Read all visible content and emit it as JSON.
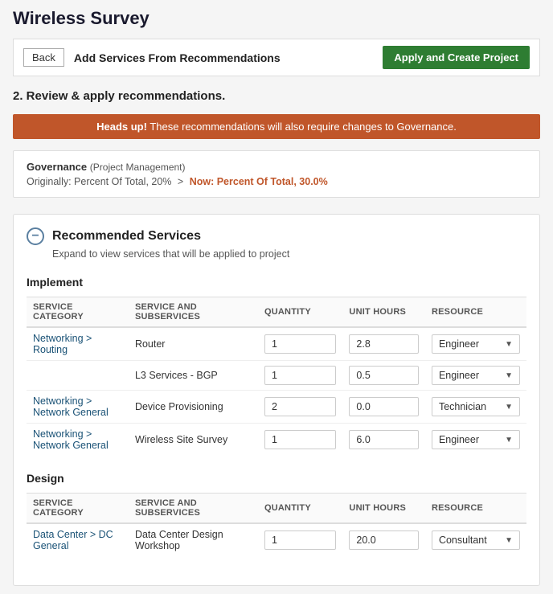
{
  "page": {
    "title": "Wireless Survey"
  },
  "topbar": {
    "back_label": "Back",
    "section_label": "Add Services From Recommendations",
    "apply_button": "Apply and Create Project"
  },
  "step": {
    "heading": "2. Review & apply recommendations."
  },
  "alert": {
    "prefix": "Heads up!",
    "message": " These recommendations will also require changes to Governance."
  },
  "governance": {
    "title": "Governance",
    "subtitle": "(Project Management)",
    "change_prefix": "Originally: Percent Of Total, 20%",
    "arrow": ">",
    "change_now": "Now: Percent Of Total, 30.0%"
  },
  "recommended": {
    "title": "Recommended Services",
    "subtitle": "Expand to view services that will be applied to project",
    "implement_label": "Implement",
    "design_label": "Design",
    "table_headers": {
      "category": "SERVICE CATEGORY",
      "service": "SERVICE AND SUBSERVICES",
      "quantity": "QUANTITY",
      "unit_hours": "UNIT HOURS",
      "resource": "RESOURCE"
    },
    "implement_rows": [
      {
        "category": "Networking > Routing",
        "service": "Router",
        "quantity": "1",
        "unit_hours": "2.8",
        "resource": "Engineer"
      },
      {
        "category": "",
        "service": "L3 Services - BGP",
        "quantity": "1",
        "unit_hours": "0.5",
        "resource": "Engineer"
      },
      {
        "category": "Networking > Network General",
        "service": "Device Provisioning",
        "quantity": "2",
        "unit_hours": "0.0",
        "resource": "Technician"
      },
      {
        "category": "Networking > Network General",
        "service": "Wireless Site Survey",
        "quantity": "1",
        "unit_hours": "6.0",
        "resource": "Engineer"
      }
    ],
    "design_rows": [
      {
        "category": "Data Center > DC General",
        "service": "Data Center Design Workshop",
        "quantity": "1",
        "unit_hours": "20.0",
        "resource": "Consultant"
      }
    ]
  }
}
